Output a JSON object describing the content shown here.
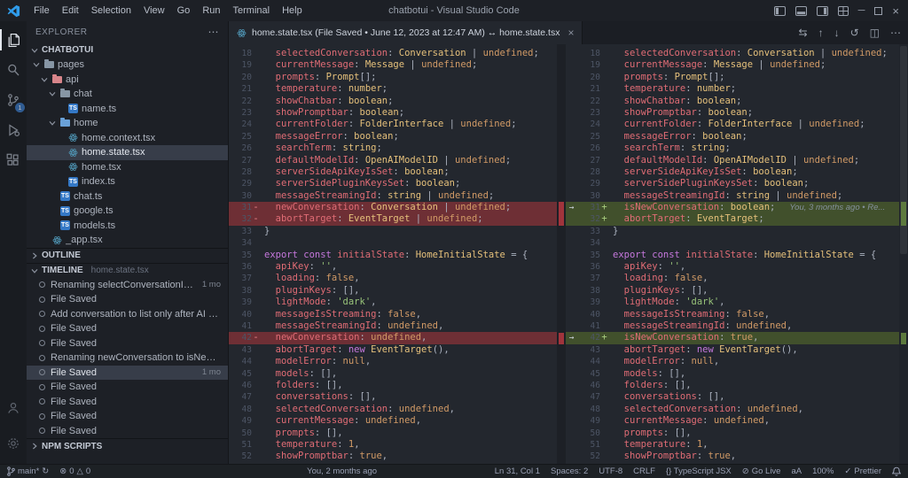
{
  "window": {
    "title": "chatbotui - Visual Studio Code",
    "menus": [
      "File",
      "Edit",
      "Selection",
      "View",
      "Go",
      "Run",
      "Terminal",
      "Help"
    ]
  },
  "activity_bar": {
    "scm_badge": "1"
  },
  "explorer": {
    "header": "EXPLORER",
    "root": "CHATBOTUI",
    "folder_colors": {
      "pages": "#8796a5",
      "api": "#d8858a",
      "chat": "#8796a5",
      "home": "#6aa1d8"
    },
    "tree": [
      {
        "label": "pages",
        "depth": 0,
        "type": "folder",
        "expanded": true
      },
      {
        "label": "api",
        "depth": 1,
        "type": "folder",
        "expanded": true
      },
      {
        "label": "chat",
        "depth": 2,
        "type": "folder",
        "expanded": true
      },
      {
        "label": "name.ts",
        "depth": 3,
        "type": "ts"
      },
      {
        "label": "home",
        "depth": 2,
        "type": "folder",
        "expanded": true
      },
      {
        "label": "home.context.tsx",
        "depth": 3,
        "type": "tsx"
      },
      {
        "label": "home.state.tsx",
        "depth": 3,
        "type": "tsx",
        "selected": true
      },
      {
        "label": "home.tsx",
        "depth": 3,
        "type": "tsx"
      },
      {
        "label": "index.ts",
        "depth": 3,
        "type": "ts"
      },
      {
        "label": "chat.ts",
        "depth": 2,
        "type": "ts"
      },
      {
        "label": "google.ts",
        "depth": 2,
        "type": "ts"
      },
      {
        "label": "models.ts",
        "depth": 2,
        "type": "ts"
      },
      {
        "label": "_app.tsx",
        "depth": 1,
        "type": "tsx"
      }
    ],
    "outline_header": "OUTLINE",
    "timeline_header": "TIMELINE",
    "timeline_file": "home.state.tsx",
    "npm_header": "NPM SCRIPTS",
    "timeline": [
      {
        "label": "Renaming selectConversationId to s...",
        "time": "1 mo"
      },
      {
        "label": "File Saved"
      },
      {
        "label": "Add conversation to list only after AI m..."
      },
      {
        "label": "File Saved"
      },
      {
        "label": "File Saved"
      },
      {
        "label": "Renaming newConversation to isNewC..."
      },
      {
        "label": "File Saved",
        "time": "1 mo",
        "selected": true
      },
      {
        "label": "File Saved"
      },
      {
        "label": "File Saved"
      },
      {
        "label": "File Saved"
      },
      {
        "label": "File Saved"
      }
    ]
  },
  "editor": {
    "tab_label": "home.state.tsx (File Saved • June 12, 2023 at 12:47 AM) ↔ home.state.tsx",
    "blame": "You, 3 months ago • Re...",
    "left": [
      {
        "n": 18,
        "t": "  selectedConversation: Conversation | undefined;"
      },
      {
        "n": 19,
        "t": "  currentMessage: Message | undefined;"
      },
      {
        "n": 20,
        "t": "  prompts: Prompt[];"
      },
      {
        "n": 21,
        "t": "  temperature: number;"
      },
      {
        "n": 22,
        "t": "  showChatbar: boolean;"
      },
      {
        "n": 23,
        "t": "  showPromptbar: boolean;"
      },
      {
        "n": 24,
        "t": "  currentFolder: FolderInterface | undefined;"
      },
      {
        "n": 25,
        "t": "  messageError: boolean;"
      },
      {
        "n": 26,
        "t": "  searchTerm: string;"
      },
      {
        "n": 27,
        "t": "  defaultModelId: OpenAIModelID | undefined;"
      },
      {
        "n": 28,
        "t": "  serverSideApiKeyIsSet: boolean;"
      },
      {
        "n": 29,
        "t": "  serverSidePluginKeysSet: boolean;"
      },
      {
        "n": 30,
        "t": "  messageStreamingId: string | undefined;"
      },
      {
        "n": 31,
        "t": "  newConversation: Conversation | undefined;",
        "k": "del"
      },
      {
        "n": 32,
        "t": "  abortTarget: EventTarget | undefined;",
        "k": "del"
      },
      {
        "n": 33,
        "t": "}"
      },
      {
        "n": 34,
        "t": ""
      },
      {
        "n": 35,
        "t": "export const initialState: HomeInitialState = {"
      },
      {
        "n": 36,
        "t": "  apiKey: '',"
      },
      {
        "n": 37,
        "t": "  loading: false,"
      },
      {
        "n": 38,
        "t": "  pluginKeys: [],"
      },
      {
        "n": 39,
        "t": "  lightMode: 'dark',"
      },
      {
        "n": 40,
        "t": "  messageIsStreaming: false,"
      },
      {
        "n": 41,
        "t": "  messageStreamingId: undefined,"
      },
      {
        "n": 42,
        "t": "  newConversation: undefined,",
        "k": "del"
      },
      {
        "n": 43,
        "t": "  abortTarget: new EventTarget(),"
      },
      {
        "n": 44,
        "t": "  modelError: null,"
      },
      {
        "n": 45,
        "t": "  models: [],"
      },
      {
        "n": 46,
        "t": "  folders: [],"
      },
      {
        "n": 47,
        "t": "  conversations: [],"
      },
      {
        "n": 48,
        "t": "  selectedConversation: undefined,"
      },
      {
        "n": 49,
        "t": "  currentMessage: undefined,"
      },
      {
        "n": 50,
        "t": "  prompts: [],"
      },
      {
        "n": 51,
        "t": "  temperature: 1,"
      },
      {
        "n": 52,
        "t": "  showPromptbar: true,"
      }
    ],
    "right": [
      {
        "n": 18,
        "t": "  selectedConversation: Conversation | undefined;"
      },
      {
        "n": 19,
        "t": "  currentMessage: Message | undefined;"
      },
      {
        "n": 20,
        "t": "  prompts: Prompt[];"
      },
      {
        "n": 21,
        "t": "  temperature: number;"
      },
      {
        "n": 22,
        "t": "  showChatbar: boolean;"
      },
      {
        "n": 23,
        "t": "  showPromptbar: boolean;"
      },
      {
        "n": 24,
        "t": "  currentFolder: FolderInterface | undefined;"
      },
      {
        "n": 25,
        "t": "  messageError: boolean;"
      },
      {
        "n": 26,
        "t": "  searchTerm: string;"
      },
      {
        "n": 27,
        "t": "  defaultModelId: OpenAIModelID | undefined;"
      },
      {
        "n": 28,
        "t": "  serverSideApiKeyIsSet: boolean;"
      },
      {
        "n": 29,
        "t": "  serverSidePluginKeysSet: boolean;"
      },
      {
        "n": 30,
        "t": "  messageStreamingId: string | undefined;"
      },
      {
        "n": 31,
        "t": "  isNewConversation: boolean;",
        "k": "add",
        "arrow": true,
        "blame": true
      },
      {
        "n": 32,
        "t": "  abortTarget: EventTarget;",
        "k": "add"
      },
      {
        "n": 33,
        "t": "}"
      },
      {
        "n": 34,
        "t": ""
      },
      {
        "n": 35,
        "t": "export const initialState: HomeInitialState = {"
      },
      {
        "n": 36,
        "t": "  apiKey: '',"
      },
      {
        "n": 37,
        "t": "  loading: false,"
      },
      {
        "n": 38,
        "t": "  pluginKeys: [],"
      },
      {
        "n": 39,
        "t": "  lightMode: 'dark',"
      },
      {
        "n": 40,
        "t": "  messageIsStreaming: false,"
      },
      {
        "n": 41,
        "t": "  messageStreamingId: undefined,"
      },
      {
        "n": 42,
        "t": "  isNewConversation: true,",
        "k": "add",
        "arrow": true
      },
      {
        "n": 43,
        "t": "  abortTarget: new EventTarget(),"
      },
      {
        "n": 44,
        "t": "  modelError: null,"
      },
      {
        "n": 45,
        "t": "  models: [],"
      },
      {
        "n": 46,
        "t": "  folders: [],"
      },
      {
        "n": 47,
        "t": "  conversations: [],"
      },
      {
        "n": 48,
        "t": "  selectedConversation: undefined,"
      },
      {
        "n": 49,
        "t": "  currentMessage: undefined,"
      },
      {
        "n": 50,
        "t": "  prompts: [],"
      },
      {
        "n": 51,
        "t": "  temperature: 1,"
      },
      {
        "n": 52,
        "t": "  showPromptbar: true,"
      }
    ]
  },
  "status": {
    "branch": "main*",
    "errors": "0",
    "warnings": "0",
    "blame": "You, 2 months ago",
    "cursor": "Ln 31, Col 1",
    "indent": "Spaces: 2",
    "encoding": "UTF-8",
    "eol": "CRLF",
    "lang": "{} TypeScript JSX",
    "live": "Go Live",
    "screencast": "aA",
    "zoom": "100%",
    "formatter": "Prettier"
  },
  "icons": {
    "more": "⋯",
    "close": "×",
    "minimize": "─",
    "arrow_right": "→",
    "prev_change": "↑",
    "next_change": "↓",
    "swap": "⇆",
    "revert": "↺",
    "split": "◫",
    "error": "⊗",
    "warning": "△",
    "sync": "↻",
    "golive": "⊘",
    "check": "✓"
  },
  "colors": {
    "property": "#e06c75",
    "type": "#e5c07b",
    "keyword": "#c678dd",
    "string": "#98c379",
    "constant": "#d19a66",
    "add_bg": "#41502c",
    "del_bg": "#6e2f35",
    "accent": "#3a78c2"
  }
}
